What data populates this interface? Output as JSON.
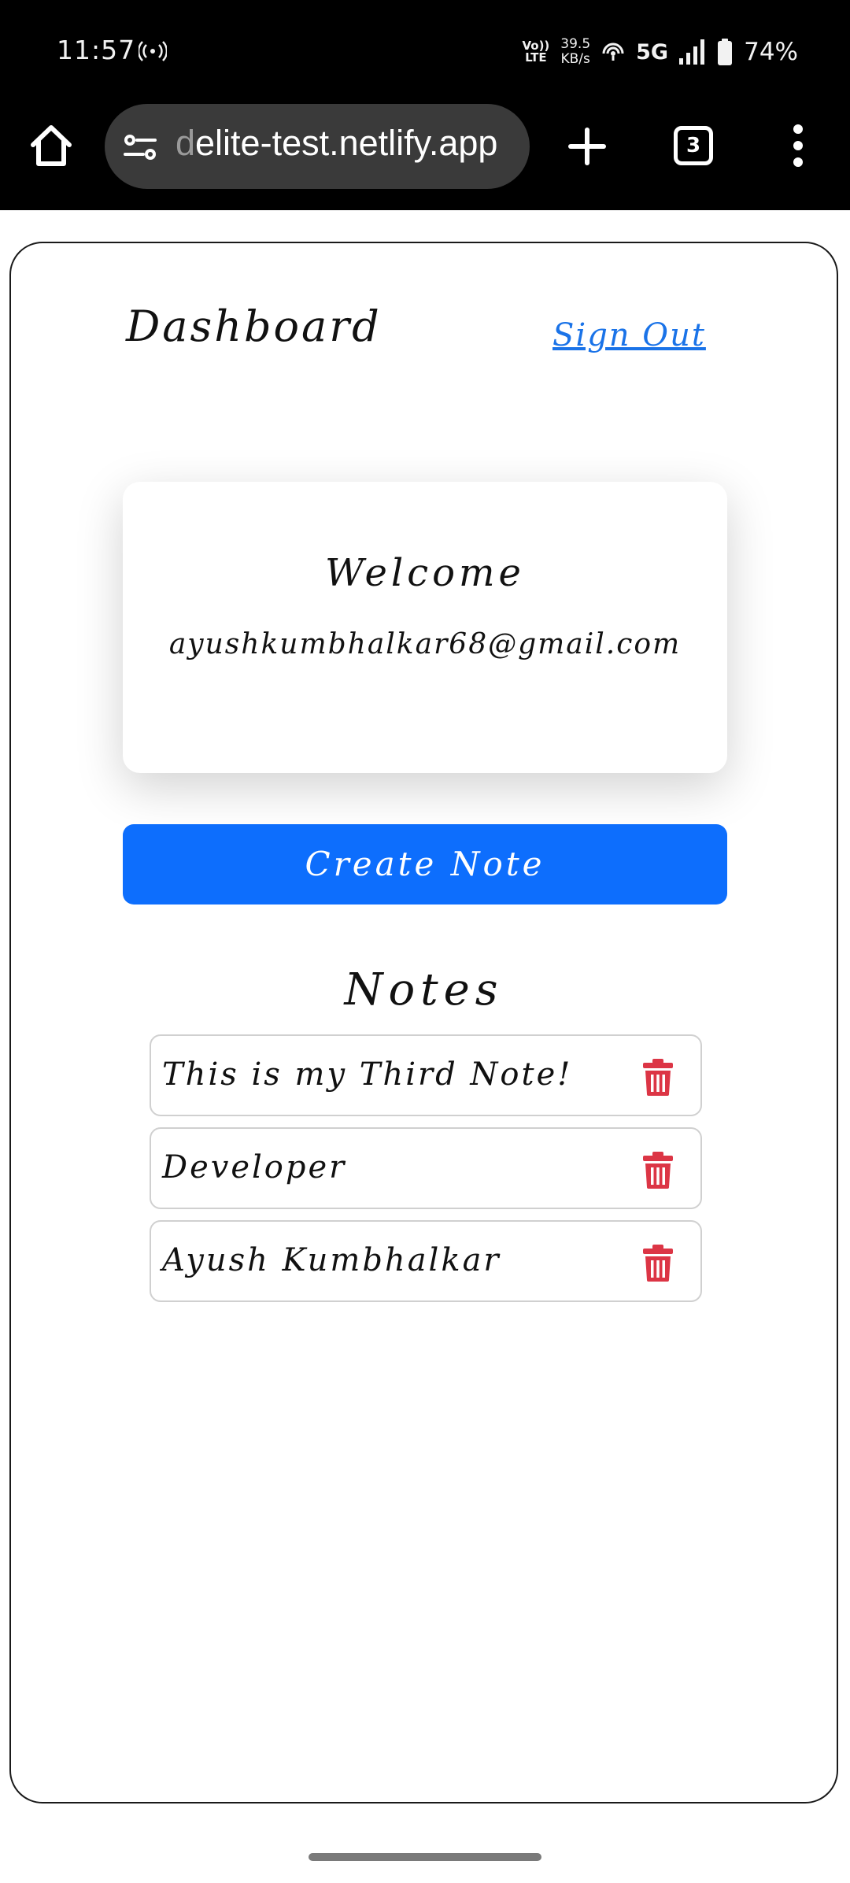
{
  "status_bar": {
    "time": "11:57",
    "volte_line1": "Vo))",
    "volte_line2": "LTE",
    "speed_value": "39.5",
    "speed_unit": "KB/s",
    "network": "5G",
    "battery": "74%",
    "icons": [
      "hotspot-icon",
      "wifi-calling-icon",
      "signal-icon",
      "battery-icon"
    ]
  },
  "browser": {
    "url_prefix": "d",
    "url_rest": "elite-test.netlify.app",
    "tab_count": "3",
    "icons": [
      "home-icon",
      "site-settings-icon",
      "plus-icon",
      "menu-dots-icon"
    ]
  },
  "page": {
    "title": "Dashboard",
    "sign_out": "Sign Out",
    "welcome": "Welcome",
    "email": "ayushkumbhalkar68@gmail.com",
    "create_note": "Create Note",
    "notes_heading": "Notes",
    "notes": [
      {
        "text": "This is my Third Note!"
      },
      {
        "text": "Developer"
      },
      {
        "text": "Ayush Kumbhalkar"
      }
    ]
  },
  "colors": {
    "primary": "#0d6efd",
    "link": "#1a73e8",
    "delete": "#dc3545",
    "browser_bg": "#000000"
  }
}
